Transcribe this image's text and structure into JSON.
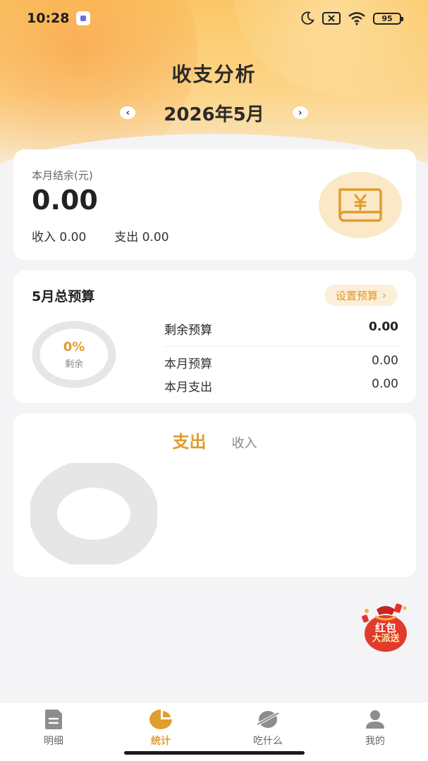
{
  "status_bar": {
    "time": "10:28",
    "battery": "95"
  },
  "header": {
    "title": "收支分析",
    "month": "2026年5月",
    "prev_icon": "chevron-left-icon",
    "next_icon": "chevron-right-icon"
  },
  "balance_card": {
    "label": "本月结余(元)",
    "value": "0.00",
    "income_label": "收入",
    "income_value": "0.00",
    "expense_label": "支出",
    "expense_value": "0.00",
    "icon": "yuan-wallet-icon"
  },
  "budget_card": {
    "title": "5月总预算",
    "set_button": "设置预算",
    "ring_percent": "0%",
    "ring_label": "剩余",
    "remaining_label": "剩余预算",
    "remaining_value": "0.00",
    "month_budget_label": "本月预算",
    "month_budget_value": "0.00",
    "month_expense_label": "本月支出",
    "month_expense_value": "0.00"
  },
  "chart_card": {
    "tab_active": "支出",
    "tab_inactive": "收入"
  },
  "promo": {
    "text_line1": "红包",
    "text_line2": "大派送"
  },
  "bottom_nav": {
    "items": [
      {
        "label": "明细",
        "icon": "document-icon"
      },
      {
        "label": "统计",
        "icon": "pie-chart-icon"
      },
      {
        "label": "吃什么",
        "icon": "planet-icon"
      },
      {
        "label": "我的",
        "icon": "user-icon"
      }
    ]
  },
  "colors": {
    "accent": "#e09c2e",
    "hero": "#fbc766",
    "background": "#f4f4f6"
  }
}
